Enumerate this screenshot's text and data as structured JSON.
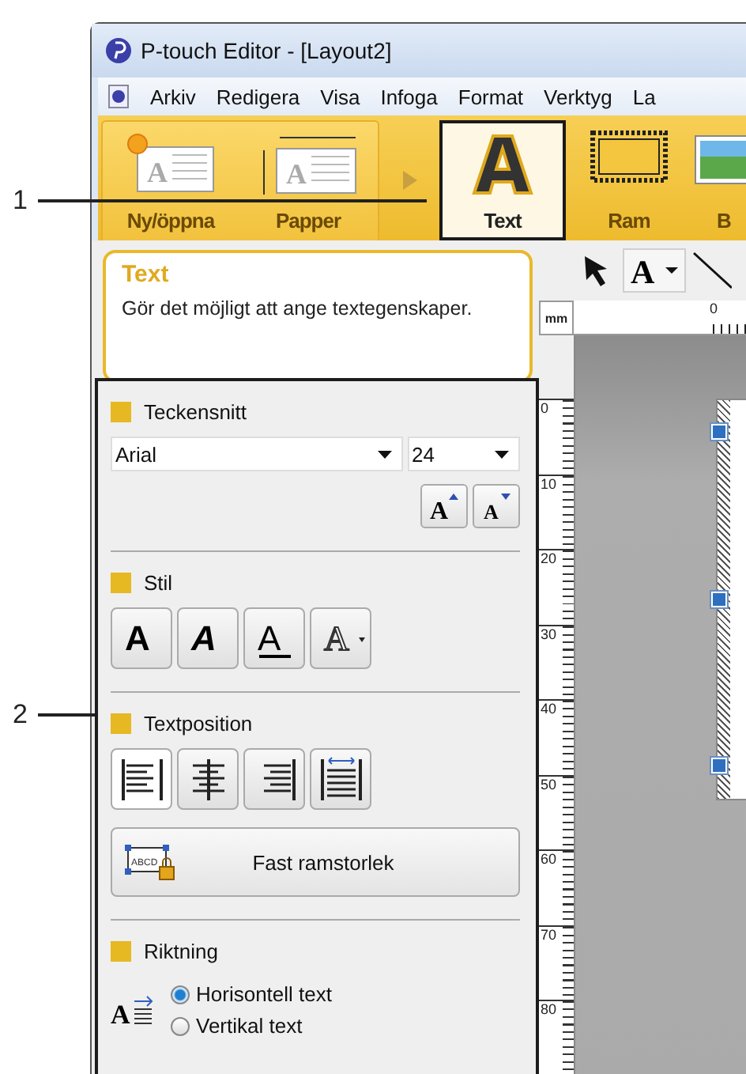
{
  "callouts": [
    {
      "label": "1"
    },
    {
      "label": "2"
    }
  ],
  "window": {
    "title": "P-touch Editor - [Layout2]"
  },
  "menu": [
    "Arkiv",
    "Redigera",
    "Visa",
    "Infoga",
    "Format",
    "Verktyg",
    "La"
  ],
  "ribbon": [
    {
      "label": "Ny/öppna",
      "kind": "new",
      "selected": false,
      "glyph": "A"
    },
    {
      "label": "Papper",
      "kind": "paper",
      "selected": false,
      "glyph": "A"
    },
    {
      "label": "Text",
      "kind": "text",
      "selected": true
    },
    {
      "label": "Ram",
      "kind": "frame",
      "selected": false
    },
    {
      "label": "B",
      "kind": "image",
      "selected": false
    }
  ],
  "info": {
    "title": "Text",
    "description": "Gör det möjligt att ange textegenskaper."
  },
  "properties": {
    "font_section": {
      "heading": "Teckensnitt",
      "font": "Arial",
      "size": "24",
      "grow_glyph": "A",
      "shrink_glyph": "A"
    },
    "style_section": {
      "heading": "Stil",
      "styles": [
        {
          "kind": "bold",
          "glyph": "A"
        },
        {
          "kind": "italic",
          "glyph": "A"
        },
        {
          "kind": "underline",
          "glyph": "A"
        },
        {
          "kind": "outline",
          "glyph": "A"
        }
      ]
    },
    "position_section": {
      "heading": "Textposition",
      "alignments": [
        {
          "kind": "left",
          "selected": true
        },
        {
          "kind": "center",
          "selected": false
        },
        {
          "kind": "right",
          "selected": false
        },
        {
          "kind": "justify",
          "selected": false
        }
      ],
      "fixed_frame_button": "Fast ramstorlek",
      "frame_glyph": "ABCD"
    },
    "direction_section": {
      "heading": "Riktning",
      "glyph": "A",
      "options": [
        {
          "label": "Horisontell text",
          "selected": true
        },
        {
          "label": "Vertikal text",
          "selected": false
        }
      ]
    }
  },
  "canvas": {
    "text_tool_glyph": "A",
    "ruler_unit": "mm",
    "top_ruler_label": "0",
    "side_ruler_labels": [
      "0",
      "10",
      "20",
      "30",
      "40",
      "50",
      "60",
      "70",
      "80"
    ]
  }
}
